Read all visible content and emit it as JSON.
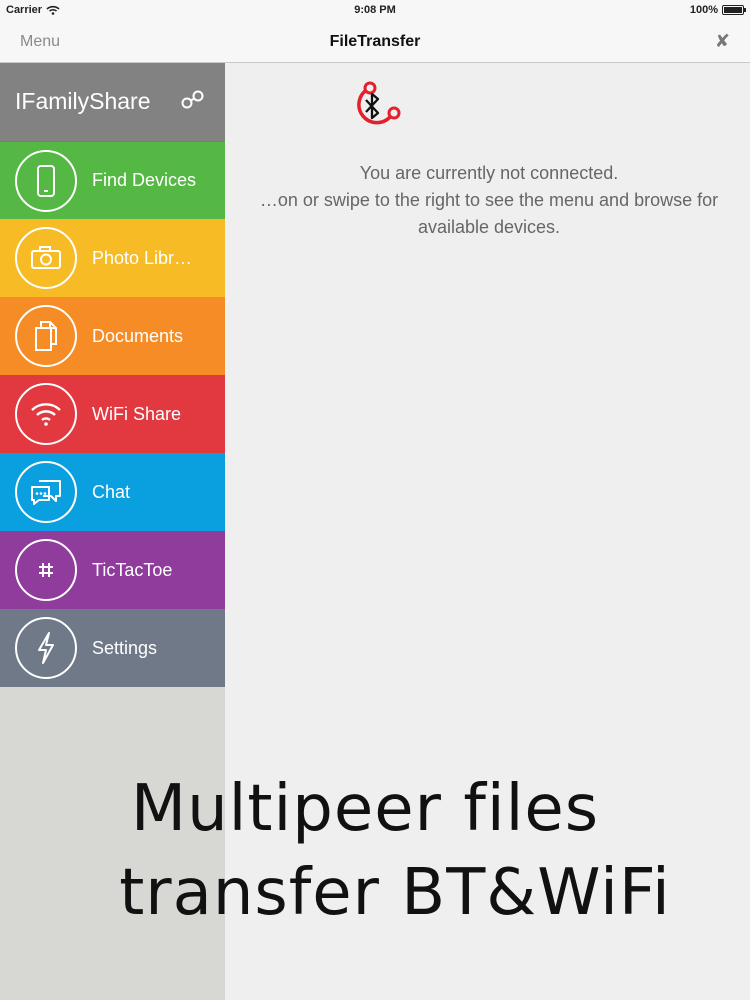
{
  "status_bar": {
    "carrier": "Carrier",
    "time": "9:08 PM",
    "battery": "100%"
  },
  "nav": {
    "menu_label": "Menu",
    "title": "FileTransfer",
    "close_glyph": "✘"
  },
  "sidebar": {
    "app_name": "IFamilyShare",
    "items": [
      {
        "label": "Find Devices",
        "icon": "phone-icon",
        "color": "#55b845"
      },
      {
        "label": "Photo Libr…",
        "icon": "camera-icon",
        "color": "#f6bb25"
      },
      {
        "label": "Documents",
        "icon": "documents-icon",
        "color": "#f58c25"
      },
      {
        "label": "WiFi Share",
        "icon": "wifi-icon",
        "color": "#e23941"
      },
      {
        "label": "Chat",
        "icon": "chat-icon",
        "color": "#0aa0df"
      },
      {
        "label": "TicTacToe",
        "icon": "hash-icon",
        "color": "#8f3c9d"
      },
      {
        "label": "Settings",
        "icon": "lightning-icon",
        "color": "#6f7988"
      }
    ]
  },
  "main": {
    "line1": "You are currently not connected.",
    "line2": "…on or swipe to the right to see the menu and browse for",
    "line3": "available devices.",
    "logo_icon": "bluetooth-icon",
    "accent": "#e3202b"
  },
  "promo": {
    "line1": "Multipeer files",
    "line2": "transfer BT&WiFi"
  }
}
